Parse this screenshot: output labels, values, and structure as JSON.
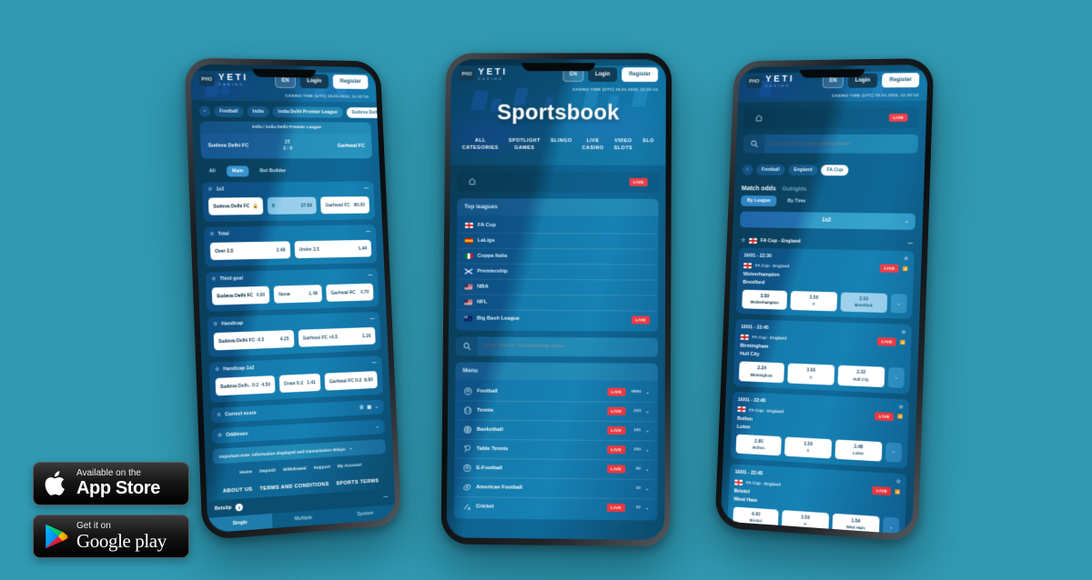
{
  "background_color": "#309ab3",
  "brand": {
    "name": "YETI",
    "sub": "CASINO",
    "mark": "PHO"
  },
  "header": {
    "lang": "EN",
    "login": "Login",
    "register": "Register",
    "casino_time": "CASINO TIME (UTC) 15.01.2024, 11:32:14"
  },
  "center_phone": {
    "title": "Sportsbook",
    "nav": [
      "ALL\nCATEGORIES",
      "SPOTLIGHT\nGAMES",
      "SLINGO",
      "LIVE\nCASINO",
      "VIDEO\nSLOTS",
      "SLO"
    ],
    "toolbar": {
      "home_icon": "home-icon",
      "live_label": "LIVE"
    },
    "top_leagues": {
      "title": "Top leagues",
      "items": [
        {
          "label": "FA Cup",
          "flag": "england",
          "live": ""
        },
        {
          "label": "LaLiga",
          "flag": "spain",
          "live": ""
        },
        {
          "label": "Coppa Italia",
          "flag": "italy",
          "live": ""
        },
        {
          "label": "Premiership",
          "flag": "scotland",
          "live": ""
        },
        {
          "label": "NBA",
          "flag": "usa",
          "live": ""
        },
        {
          "label": "NFL",
          "flag": "usa",
          "live": ""
        },
        {
          "label": "Big Bash League",
          "flag": "australia",
          "live": "LIVE"
        }
      ]
    },
    "search": {
      "placeholder": "Enter Team or Championship name",
      "icon": "search-icon"
    },
    "menu": {
      "title": "Menu",
      "items": [
        {
          "label": "Football",
          "icon": "football-icon",
          "live": "LIVE",
          "count": "9994"
        },
        {
          "label": "Tennis",
          "icon": "tennis-icon",
          "live": "LIVE",
          "count": "203"
        },
        {
          "label": "Basketball",
          "icon": "basketball-icon",
          "live": "LIVE",
          "count": "181"
        },
        {
          "label": "Table Tennis",
          "icon": "table-tennis-icon",
          "live": "LIVE",
          "count": "194"
        },
        {
          "label": "E-Football",
          "icon": "efootball-icon",
          "live": "LIVE",
          "count": "60"
        },
        {
          "label": "American Football",
          "icon": "american-football-icon",
          "live": "",
          "count": "10"
        },
        {
          "label": "Cricket",
          "icon": "cricket-icon",
          "live": "LIVE",
          "count": "22"
        }
      ]
    }
  },
  "left_phone": {
    "breadcrumbs": [
      "Football",
      "India",
      "India Delhi Premier League"
    ],
    "current_event_crumb": "Sudeva Delhi FC vs. Garhwal FC",
    "event": {
      "league": "India / India Delhi Premier League",
      "home": "Sudeva Delhi FC",
      "away": "Garhwal FC",
      "period": "2T",
      "score": "2 : 0"
    },
    "market_tabs": [
      {
        "label": "All",
        "active": false
      },
      {
        "label": "Main",
        "active": true
      },
      {
        "label": "Bet Builder",
        "active": false
      }
    ],
    "markets": [
      {
        "name": "1x2",
        "selections": [
          {
            "name": "Sudeva Delhi FC",
            "odd": "",
            "locked": true,
            "selected": false
          },
          {
            "name": "X",
            "odd": "27.00",
            "locked": false,
            "selected": true
          },
          {
            "name": "Garhwal FC",
            "odd": "80.00",
            "locked": false,
            "selected": false
          }
        ]
      },
      {
        "name": "Total",
        "selections": [
          {
            "name": "Over 2.5",
            "odd": "2.48",
            "locked": false,
            "selected": false
          },
          {
            "name": "Under 2.5",
            "odd": "1.44",
            "locked": false,
            "selected": false
          }
        ]
      },
      {
        "name": "Third goal",
        "selections": [
          {
            "name": "Sudeva Delhi FC",
            "odd": "4.00",
            "locked": false,
            "selected": false
          },
          {
            "name": "None",
            "odd": "1.48",
            "locked": false,
            "selected": false
          },
          {
            "name": "Garhwal FC",
            "odd": "4.70",
            "locked": false,
            "selected": false
          }
        ]
      },
      {
        "name": "Handicap",
        "selections": [
          {
            "name": "Sudeva Delhi FC -0.5",
            "odd": "4.25",
            "locked": false,
            "selected": false
          },
          {
            "name": "Garhwal FC +0.5",
            "odd": "1.16",
            "locked": false,
            "selected": false
          }
        ]
      },
      {
        "name": "Handicap 1x2",
        "selections": [
          {
            "name": "Sudeva Delh.. 0:2",
            "odd": "4.50",
            "locked": false,
            "selected": false
          },
          {
            "name": "Draw 0:2",
            "odd": "1.41",
            "locked": false,
            "selected": false
          },
          {
            "name": "Garhwal FC 0:2",
            "odd": "8.50",
            "locked": false,
            "selected": false
          }
        ]
      },
      {
        "name": "Correct score",
        "selections": []
      },
      {
        "name": "Odd/even",
        "selections": []
      }
    ],
    "notice": "Important note: information displayed and transmission delays",
    "footer_links": [
      "Home",
      "Deposit",
      "Withdrawal",
      "Support",
      "My Account"
    ],
    "legal_links": [
      "ABOUT US",
      "TERMS AND CONDITIONS",
      "SPORTS TERMS"
    ],
    "betslip": {
      "title": "Betslip",
      "count": "1",
      "tabs": [
        {
          "label": "Single",
          "active": true
        },
        {
          "label": "Multiple",
          "active": false
        },
        {
          "label": "System",
          "active": false
        }
      ]
    }
  },
  "right_phone": {
    "toolbar": {
      "home_icon": "home-icon",
      "live_label": "LIVE"
    },
    "search": {
      "placeholder": "Enter Team or Championship name",
      "icon": "search-icon"
    },
    "breadcrumbs": [
      "Football",
      "England"
    ],
    "current_crumb": "FA Cup",
    "segments": [
      {
        "label": "Match odds",
        "active": true
      },
      {
        "label": "Outrights",
        "active": false
      }
    ],
    "view_pills": [
      {
        "label": "By League",
        "active": true
      },
      {
        "label": "By Time",
        "active": false
      }
    ],
    "market_select": "1x2",
    "league_header": {
      "label": "FA Cup - England",
      "flag": "england"
    },
    "matches": [
      {
        "datetime": "16/01 - 22:30",
        "league": "FA Cup - England",
        "home": "Wolverhampton",
        "away": "Brentford",
        "live": "LIVE",
        "odds": [
          {
            "value": "3.50",
            "name": "Wolverhampton",
            "selected": false
          },
          {
            "value": "3.50",
            "name": "X",
            "selected": false
          },
          {
            "value": "2.10",
            "name": "Brentford",
            "selected": true
          }
        ]
      },
      {
        "datetime": "16/01 - 22:45",
        "league": "FA Cup - England",
        "home": "Birmingham",
        "away": "Hull City",
        "live": "LIVE",
        "odds": [
          {
            "value": "2.24",
            "name": "Birmingham",
            "selected": false
          },
          {
            "value": "3.66",
            "name": "X",
            "selected": false
          },
          {
            "value": "2.33",
            "name": "Hull City",
            "selected": false
          }
        ]
      },
      {
        "datetime": "16/01 - 22:45",
        "league": "FA Cup - England",
        "home": "Bolton",
        "away": "Luton",
        "live": "LIVE",
        "odds": [
          {
            "value": "2.85",
            "name": "Bolton",
            "selected": false
          },
          {
            "value": "3.50",
            "name": "X",
            "selected": false
          },
          {
            "value": "2.48",
            "name": "Luton",
            "selected": false
          }
        ]
      },
      {
        "datetime": "16/01 - 22:45",
        "league": "FA Cup - England",
        "home": "Bristol",
        "away": "West Ham",
        "live": "LIVE",
        "odds": [
          {
            "value": "4.00",
            "name": "Bristol",
            "selected": false
          },
          {
            "value": "3.50",
            "name": "X",
            "selected": false
          },
          {
            "value": "1.54",
            "name": "West Ham",
            "selected": false
          }
        ]
      }
    ]
  },
  "store_badges": [
    {
      "small": "Available on the",
      "large": "App Store",
      "icon": "apple-icon"
    },
    {
      "small": "Get it on",
      "large": "Google play",
      "icon": "google-play-icon"
    }
  ]
}
